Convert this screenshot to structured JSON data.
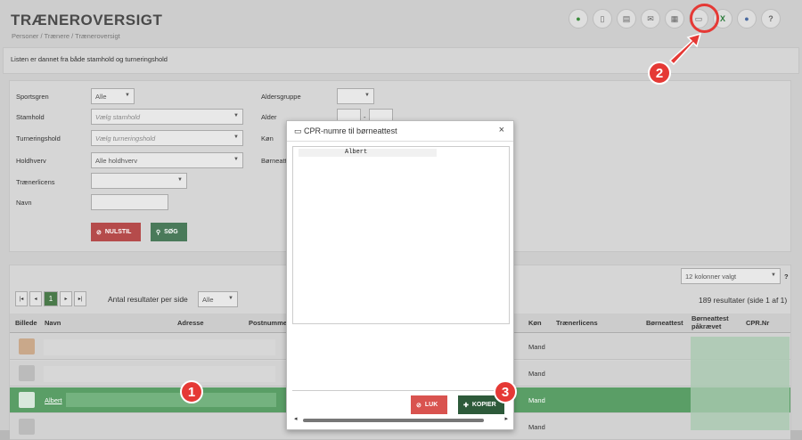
{
  "header": {
    "title": "TRÆNEROVERSIGT",
    "breadcrumb": "Personer / Trænere / Træneroversigt"
  },
  "toolbar": {
    "icons": [
      "add-icon",
      "document-icon",
      "report-icon",
      "mail-icon",
      "calculator-icon",
      "certificate-icon",
      "excel-icon",
      "globe-icon",
      "help-icon"
    ]
  },
  "info": {
    "text": "Listen er dannet fra både stamhold og turneringshold"
  },
  "filter": {
    "sportsgren_label": "Sportsgren",
    "sportsgren_value": "Alle",
    "stamhold_label": "Stamhold",
    "stamhold_placeholder": "Vælg stamhold",
    "turneringshold_label": "Turneringshold",
    "turneringshold_placeholder": "Vælg turneringshold",
    "holdhverv_label": "Holdhverv",
    "holdhverv_value": "Alle holdhverv",
    "traenerlicens_label": "Trænerlicens",
    "navn_label": "Navn",
    "aldersgruppe_label": "Aldersgruppe",
    "alder_label": "Alder",
    "alder_sep": "-",
    "koen_label": "Køn",
    "boerneattest_label": "Børneatt",
    "reset_label": "NULSTIL",
    "search_label": "SØG"
  },
  "grid": {
    "columns_selected": "12 kolonner valgt",
    "help": "?",
    "results": "189 resultater (side 1 af 1)",
    "page": "1",
    "per_page_label": "Antal resultater per side",
    "per_page_value": "Alle",
    "headers": [
      "Billede",
      "Navn",
      "Adresse",
      "Postnumme",
      "Køn",
      "Trænerlicens",
      "Børneattest",
      "Børneattest påkrævet",
      "CPR.Nr"
    ],
    "rows": [
      {
        "name": "",
        "gender": "Mand"
      },
      {
        "name": "",
        "gender": "Mand"
      },
      {
        "name": "Albert",
        "gender": "Mand"
      },
      {
        "name": "",
        "gender": "Mand"
      }
    ]
  },
  "modal": {
    "title": "CPR-numre til børneattest",
    "line": "Albert",
    "close": "×",
    "luk": "LUK",
    "kopier": "KOPIER"
  },
  "badges": [
    "1",
    "2",
    "3"
  ]
}
